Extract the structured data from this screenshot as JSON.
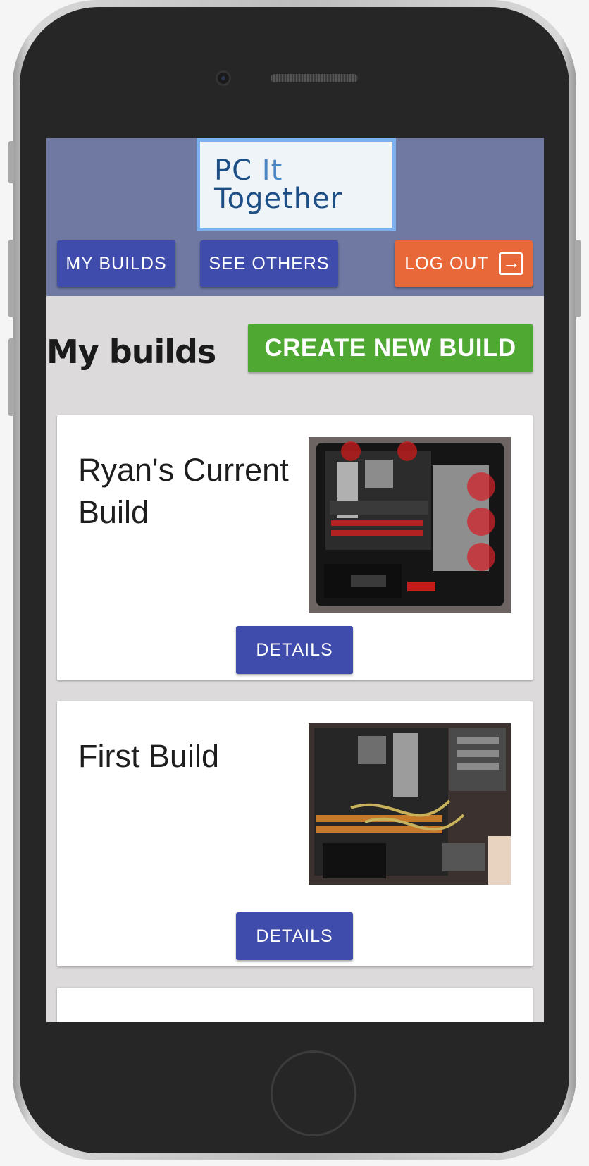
{
  "logo": {
    "line1_main": "PC",
    "line1_accent": " It",
    "line2": "Together"
  },
  "nav": {
    "my_builds": "MY BUILDS",
    "see_others": "SEE OTHERS",
    "log_out": "LOG OUT"
  },
  "main": {
    "title": "My builds",
    "create_button": "CREATE NEW BUILD"
  },
  "builds": [
    {
      "title": "Ryan's Current Build",
      "details_label": "DETAILS",
      "image": "pc-case-photo-red-fans"
    },
    {
      "title": "First Build",
      "details_label": "DETAILS",
      "image": "pc-case-photo-open-side"
    }
  ],
  "colors": {
    "header_bg": "#6f79a2",
    "nav_button": "#3f4cac",
    "logout_button": "#e9683a",
    "create_button": "#4ea832",
    "page_bg": "#dcdada"
  },
  "icons": {
    "logout": "logout-arrow-icon"
  }
}
